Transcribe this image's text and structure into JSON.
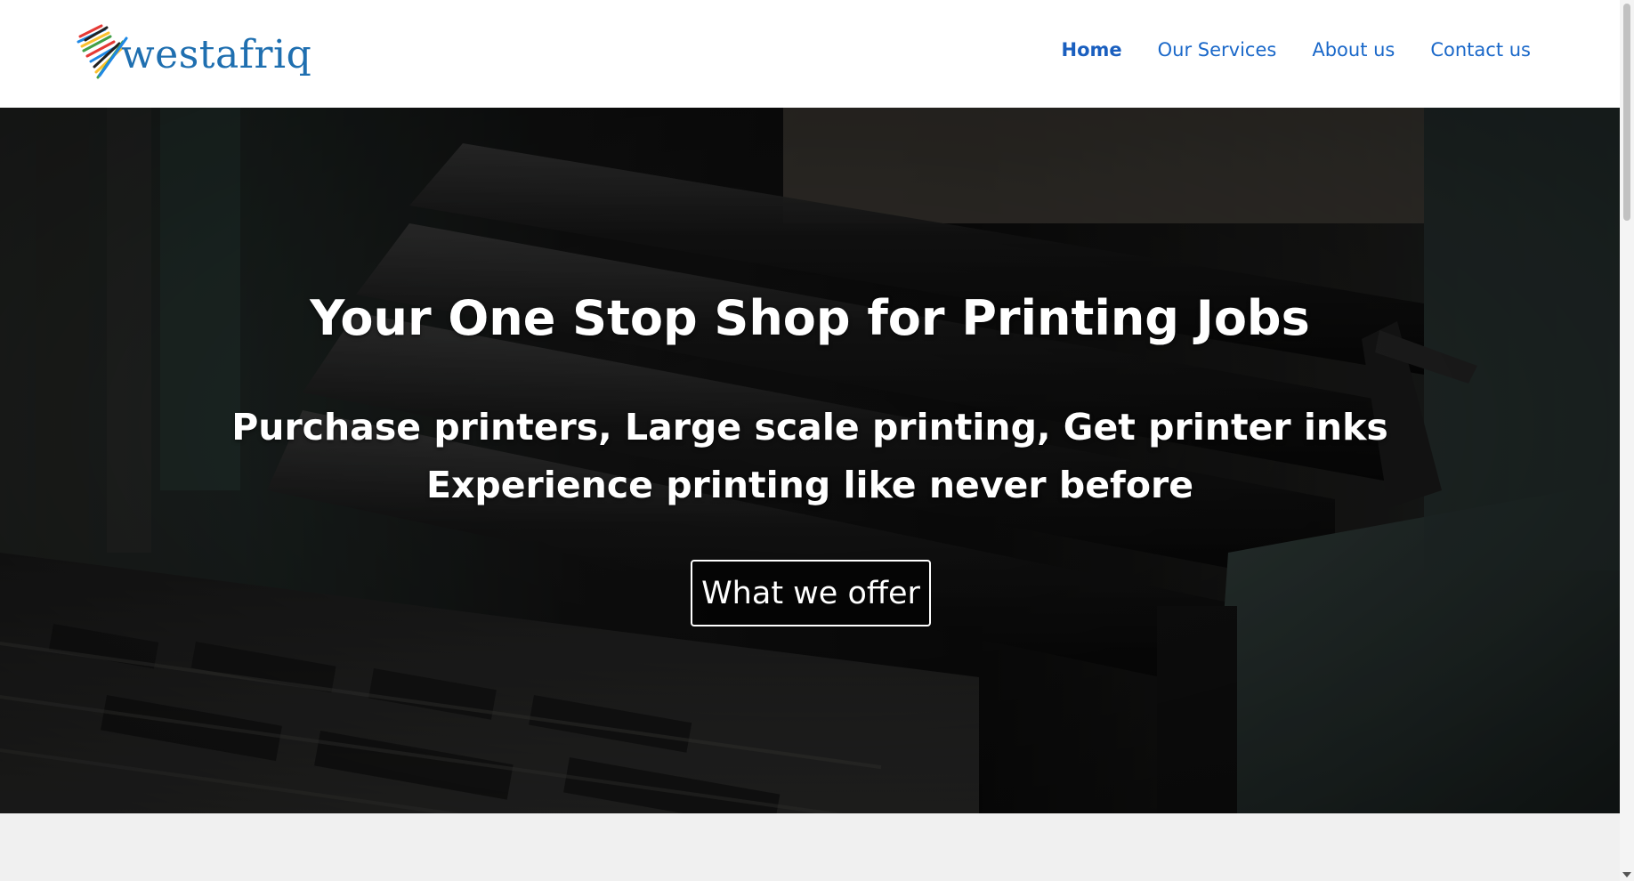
{
  "brand": {
    "name": "westafriq",
    "color": "#1f6fb0"
  },
  "nav": {
    "items": [
      {
        "label": "Home",
        "active": true
      },
      {
        "label": "Our Services",
        "active": false
      },
      {
        "label": "About us",
        "active": false
      },
      {
        "label": "Contact us",
        "active": false
      }
    ],
    "color": "#1a68c9"
  },
  "hero": {
    "title": "Your One Stop Shop for Printing Jobs",
    "subtitle_line1": "Purchase printers, Large scale printing, Get printer inks",
    "subtitle_line2": "Experience printing like never before",
    "cta_label": "What we offer"
  }
}
